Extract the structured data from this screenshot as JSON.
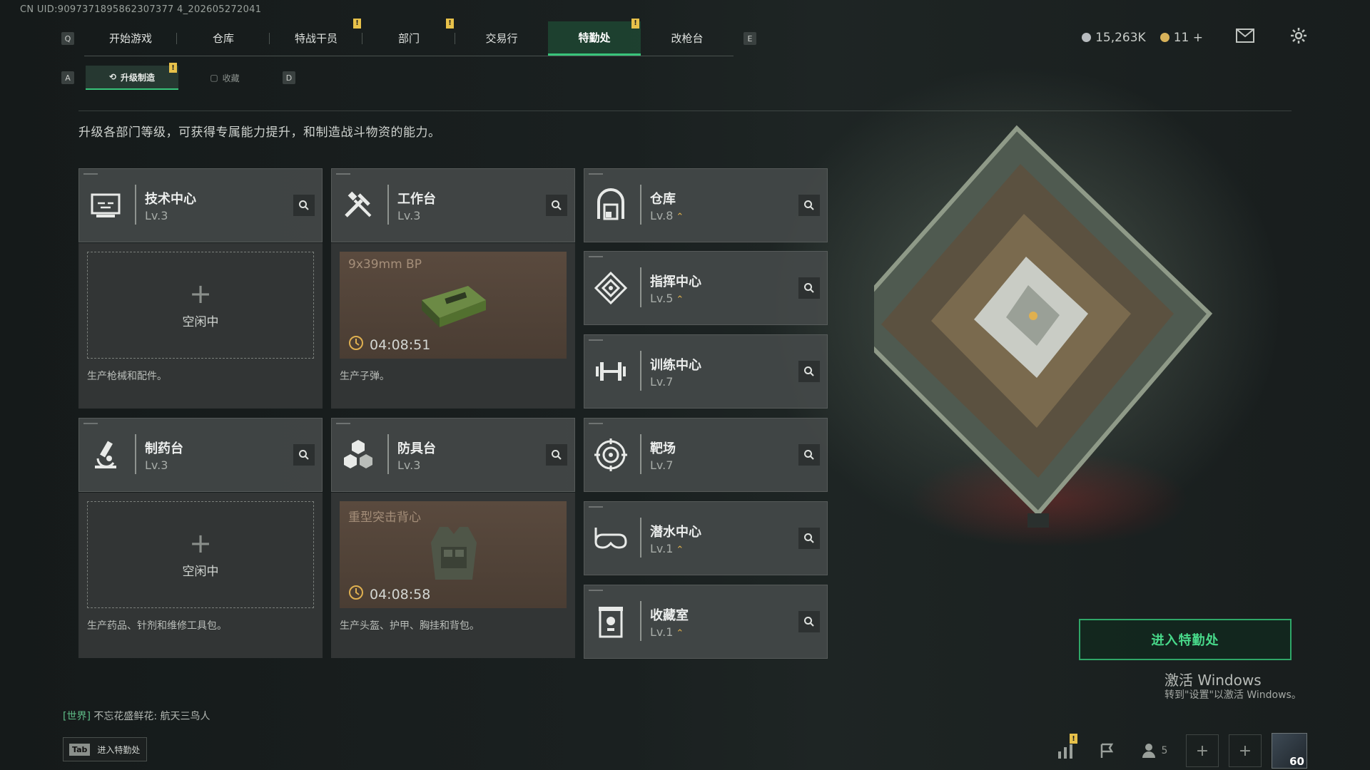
{
  "uid": "CN UID:9097371895862307377 4_202605272041",
  "nav": {
    "left_key": "Q",
    "right_key": "E",
    "tabs": [
      {
        "label": "开始游戏"
      },
      {
        "label": "仓库"
      },
      {
        "label": "特战干员",
        "badge": "!"
      },
      {
        "label": "部门",
        "badge": "!"
      },
      {
        "label": "交易行"
      },
      {
        "label": "特勤处",
        "badge": "!",
        "active": true
      },
      {
        "label": "改枪台"
      }
    ]
  },
  "subnav": {
    "left_key": "A",
    "right_key": "D",
    "tabs": [
      {
        "label": "升级制造",
        "badge": "!",
        "active": true
      },
      {
        "label": "收藏"
      }
    ]
  },
  "description": "升级各部门等级，可获得专属能力提升，和制造战斗物资的能力。",
  "currency": {
    "silver": "15,263K",
    "gold": "11"
  },
  "colors": {
    "accent": "#38c47a",
    "badge": "#e7c14a",
    "upgrade": "#e2b14a"
  },
  "departments_left": [
    {
      "name": "技术中心",
      "level": "Lv.3",
      "icon": "monitor-icon",
      "slot": {
        "state": "idle",
        "idle_text": "空闲中",
        "desc": "生产枪械和配件。"
      }
    },
    {
      "name": "工作台",
      "level": "Lv.3",
      "icon": "tools-icon",
      "slot": {
        "state": "producing",
        "item": "9x39mm BP",
        "timer": "04:08:51",
        "desc": "生产子弹。"
      }
    },
    {
      "name": "制药台",
      "level": "Lv.3",
      "icon": "microscope-icon",
      "slot": {
        "state": "idle",
        "idle_text": "空闲中",
        "desc": "生产药品、针剂和维修工具包。"
      }
    },
    {
      "name": "防具台",
      "level": "Lv.3",
      "icon": "cubes-icon",
      "slot": {
        "state": "producing",
        "item": "重型突击背心",
        "timer": "04:08:58",
        "desc": "生产头盔、护甲、胸挂和背包。"
      }
    }
  ],
  "departments_right": [
    {
      "name": "仓库",
      "level": "Lv.8",
      "upgrade": "⌃",
      "icon": "storage-icon"
    },
    {
      "name": "指挥中心",
      "level": "Lv.5",
      "upgrade": "⌃",
      "icon": "command-icon"
    },
    {
      "name": "训练中心",
      "level": "Lv.7",
      "icon": "dumbbell-icon"
    },
    {
      "name": "靶场",
      "level": "Lv.7",
      "icon": "target-icon"
    },
    {
      "name": "潜水中心",
      "level": "Lv.1",
      "upgrade": "⌃",
      "icon": "goggles-icon"
    },
    {
      "name": "收藏室",
      "level": "Lv.1",
      "upgrade": "⌃",
      "icon": "trophy-icon"
    }
  ],
  "enter_button": "进入特勤处",
  "windows": {
    "line1": "激活 Windows",
    "line2": "转到\"设置\"以激活 Windows。"
  },
  "chat": {
    "channel": "[世界]",
    "message": "不忘花盛鲜花: 航天三鸟人"
  },
  "tab_hint": {
    "key": "Tab",
    "label": "进入特勤处"
  },
  "bottom": {
    "friends_count": "5",
    "player_level": "60",
    "stats_badge": "!"
  }
}
